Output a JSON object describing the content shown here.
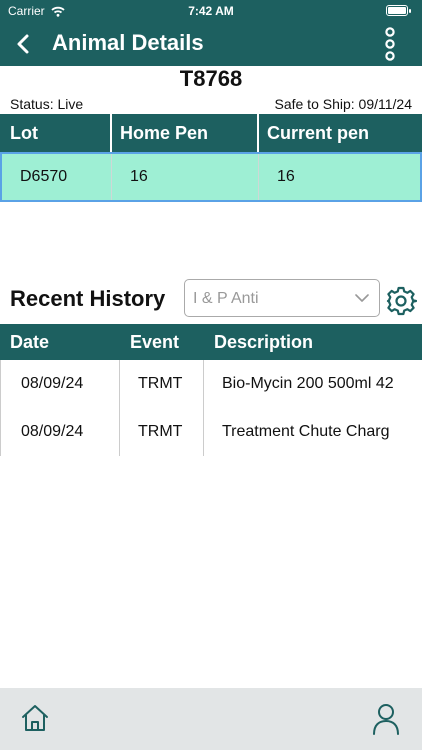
{
  "status_bar": {
    "carrier": "Carrier",
    "time": "7:42 AM"
  },
  "nav": {
    "title": "Animal Details"
  },
  "animal": {
    "id": "T8768",
    "status": "Status: Live",
    "safe_to_ship": "Safe to Ship: 09/11/24"
  },
  "lot_table": {
    "headers": [
      "Lot",
      "Home Pen",
      "Current pen"
    ],
    "row": [
      "D6570",
      "16",
      "16"
    ]
  },
  "history": {
    "title": "Recent History",
    "filter_value": "I & P Anti",
    "headers": [
      "Date",
      "Event",
      "Description"
    ],
    "rows": [
      [
        "08/09/24",
        "TRMT",
        "Bio-Mycin 200 500ml 42"
      ],
      [
        "08/09/24",
        "TRMT",
        "Treatment Chute Charg"
      ]
    ]
  },
  "colors": {
    "primary": "#1d6060",
    "selected_row": "#9eefd4",
    "selected_border": "#5aa2e6",
    "tab_bar": "#e2e5e6"
  },
  "icons": {
    "back": "chevron-left-icon",
    "more": "more-vertical-icon",
    "settings": "gear-icon",
    "home": "home-icon",
    "profile": "user-icon"
  }
}
